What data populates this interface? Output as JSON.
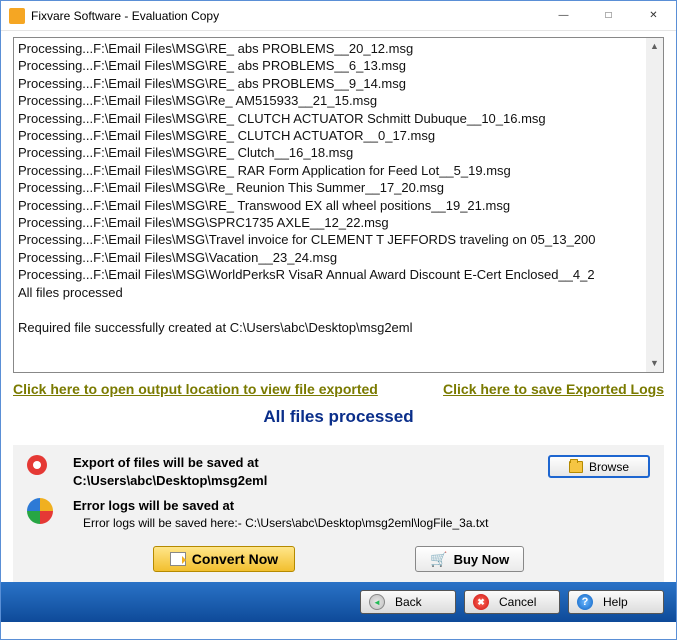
{
  "title": "Fixvare Software - Evaluation Copy",
  "log_lines": [
    "Processing...F:\\Email Files\\MSG\\RE_ abs PROBLEMS__20_12.msg",
    "Processing...F:\\Email Files\\MSG\\RE_ abs PROBLEMS__6_13.msg",
    "Processing...F:\\Email Files\\MSG\\RE_ abs PROBLEMS__9_14.msg",
    "Processing...F:\\Email Files\\MSG\\Re_ AM515933__21_15.msg",
    "Processing...F:\\Email Files\\MSG\\RE_ CLUTCH ACTUATOR Schmitt Dubuque__10_16.msg",
    "Processing...F:\\Email Files\\MSG\\RE_ CLUTCH ACTUATOR__0_17.msg",
    "Processing...F:\\Email Files\\MSG\\RE_ Clutch__16_18.msg",
    "Processing...F:\\Email Files\\MSG\\RE_ RAR Form Application for Feed Lot__5_19.msg",
    "Processing...F:\\Email Files\\MSG\\Re_ Reunion This Summer__17_20.msg",
    "Processing...F:\\Email Files\\MSG\\RE_ Transwood EX all wheel positions__19_21.msg",
    "Processing...F:\\Email Files\\MSG\\SPRC1735 AXLE__12_22.msg",
    "Processing...F:\\Email Files\\MSG\\Travel invoice for CLEMENT T JEFFORDS traveling on 05_13_200",
    "Processing...F:\\Email Files\\MSG\\Vacation__23_24.msg",
    "Processing...F:\\Email Files\\MSG\\WorldPerksR VisaR Annual Award Discount E-Cert Enclosed__4_2",
    "All files processed",
    "",
    "Required file successfully created at C:\\Users\\abc\\Desktop\\msg2eml"
  ],
  "links": {
    "open_output": "Click here to open output location to view file exported",
    "save_logs": "Click here to save Exported Logs"
  },
  "status": "All files processed",
  "export": {
    "heading": "Export of files will be saved at",
    "path": "C:\\Users\\abc\\Desktop\\msg2eml",
    "browse": "Browse"
  },
  "errors": {
    "heading": "Error logs will be saved at",
    "path": "Error logs will be saved here:- C:\\Users\\abc\\Desktop\\msg2eml\\logFile_3a.txt"
  },
  "buttons": {
    "convert": "Convert Now",
    "buy": "Buy Now",
    "back": "Back",
    "cancel": "Cancel",
    "help": "Help"
  }
}
